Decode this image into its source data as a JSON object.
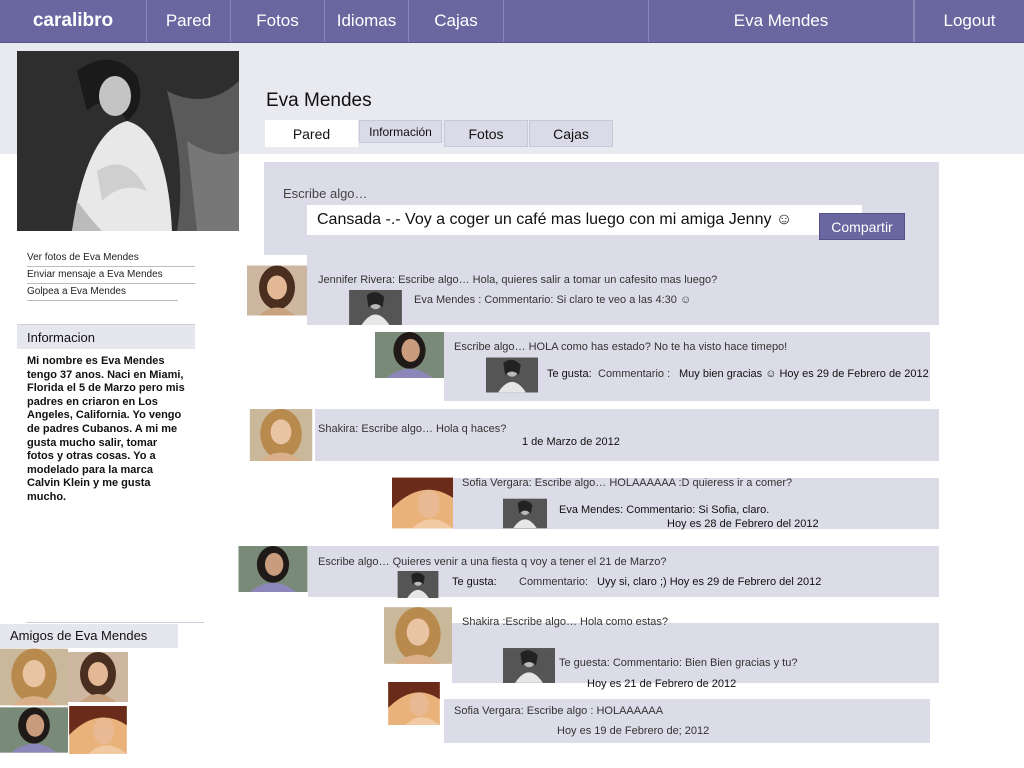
{
  "nav": {
    "brand": "caralibro",
    "items": [
      "Pared",
      "Fotos",
      "Idiomas",
      "Cajas"
    ],
    "user": "Eva Mendes",
    "logout": "Logout"
  },
  "profile": {
    "name": "Eva Mendes",
    "tabs": [
      "Pared",
      "Información",
      "Fotos",
      "Cajas"
    ]
  },
  "sidebar": {
    "links": [
      "Ver fotos de Eva Mendes",
      "Enviar mensaje a Eva Mendes",
      "Golpea a Eva Mendes"
    ],
    "info_title": "Informacion",
    "info_text": "Mi nombre es Eva Mendes tengo 37 anos.  Naci en Miami, Florida el 5 de Marzo pero mis padres en criaron en Los Angeles, California. Yo vengo de padres Cubanos.  A mi me gusta mucho salir, tomar fotos y otras cosas. Yo a modelado para la marca Calvin Klein y me gusta mucho.",
    "friends_title": "Amigos de Eva Mendes"
  },
  "composer": {
    "label": "Escribe algo…",
    "value": "Cansada -.- Voy a coger un café mas luego con mi amiga Jenny ☺",
    "button": "Compartir"
  },
  "posts": [
    {
      "text": "Jennifer Rivera:  Escribe algo… Hola, quieres salir a tomar un cafesito mas luego?",
      "reply": "Eva Mendes : Commentario: Si claro te veo a las 4:30 ☺"
    },
    {
      "text": "Escribe algo… HOLA como has estado? No te ha visto hace timepo!",
      "reply_label": "Te gusta:",
      "reply_mid": "Commentario :",
      "reply": "Muy bien gracias ☺ Hoy es 29 de Febrero de 2012"
    },
    {
      "text": "Shakira: Escribe algo… Hola q haces?",
      "date": "1 de Marzo de 2012"
    },
    {
      "text": "Sofia Vergara: Escribe algo… HOLAAAAAA :D quieress ir a comer?",
      "reply": "Eva Mendes: Commentario: Si Sofia, claro.",
      "date": "Hoy es 28 de Febrero del 2012"
    },
    {
      "text": "Escribe algo… Quieres venir a una fiesta q voy a tener el 21 de Marzo?",
      "reply_label": "Te gusta:",
      "reply_mid": "Commentario:",
      "reply": "Uyy si, claro ;)   Hoy es 29 de Febrero del 2012"
    },
    {
      "text": "Shakira :Escribe algo… Hola como estas?",
      "reply": "Te guesta: Commentario: Bien Bien gracias y tu?",
      "date": "Hoy es 21 de Febrero de 2012"
    },
    {
      "text": "Sofia Vergara: Escribe algo : HOLAAAAAA",
      "date": "Hoy es 19 de Febrero de; 2012"
    }
  ],
  "colors": {
    "accent": "#6a66a0",
    "panel": "#dcdce8",
    "band": "#e9e9f0"
  }
}
